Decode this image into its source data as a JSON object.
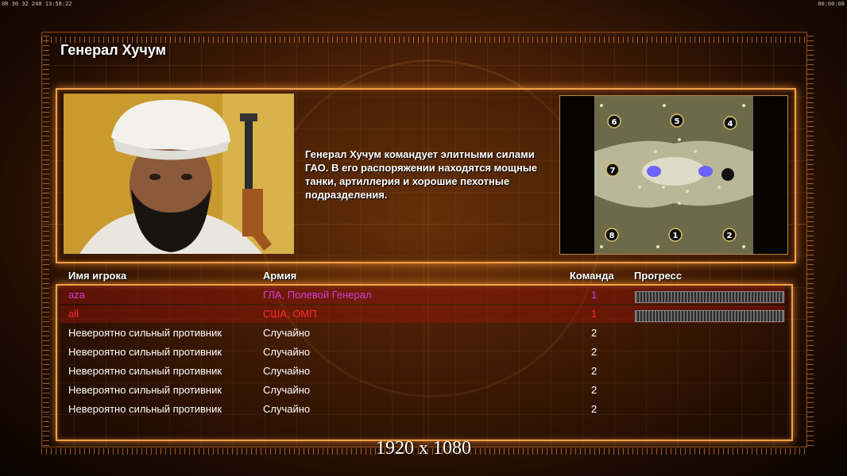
{
  "topbar": {
    "left_text": "0R 30 32 240 13:58:22",
    "right_text": "00:00:00"
  },
  "page_title": "Генерал Хучум",
  "general": {
    "description": "Генерал Хучум командует элитными силами ГАО. В его распоряжении находятся мощные танки, артиллерия и хорошие пехотные подразделения."
  },
  "map": {
    "slots": [
      "6",
      "5",
      "4",
      "7",
      "8",
      "1",
      "2"
    ]
  },
  "roster": {
    "headers": {
      "name": "Имя игрока",
      "army": "Армия",
      "team": "Команда",
      "progress": "Прогресс"
    },
    "players": [
      {
        "name": "aza",
        "army": "ГЛА, Полевой Генерал",
        "team": "1",
        "color": "#d63ad6",
        "progress": 1.0
      },
      {
        "name": "all",
        "army": "США, ОМП",
        "team": "1",
        "color": "#ff2a2a",
        "progress": 1.0
      },
      {
        "name": "Невероятно сильный противник",
        "army": "Случайно",
        "team": "2",
        "color": "#ffffff"
      },
      {
        "name": "Невероятно сильный противник",
        "army": "Случайно",
        "team": "2",
        "color": "#ffffff"
      },
      {
        "name": "Невероятно сильный противник",
        "army": "Случайно",
        "team": "2",
        "color": "#ffffff"
      },
      {
        "name": "Невероятно сильный противник",
        "army": "Случайно",
        "team": "2",
        "color": "#ffffff"
      },
      {
        "name": "Невероятно сильный противник",
        "army": "Случайно",
        "team": "2",
        "color": "#ffffff"
      }
    ]
  },
  "footer_text": "1920 x 1080",
  "colors": {
    "accent": "#f0a048",
    "highlight_row": "#96140a"
  }
}
